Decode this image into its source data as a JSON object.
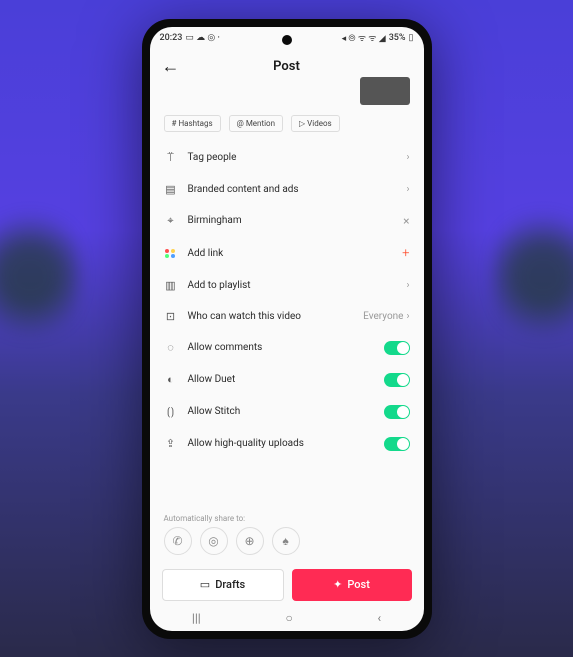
{
  "status": {
    "time": "20:23",
    "battery": "35%"
  },
  "header": {
    "title": "Post"
  },
  "chips": {
    "hashtags": "Hashtags",
    "mention": "Mention",
    "videos": "Videos"
  },
  "rows": {
    "tag_people": "Tag people",
    "branded": "Branded content and ads",
    "location": "Birmingham",
    "add_link": "Add link",
    "playlist": "Add to playlist",
    "privacy_label": "Who can watch this video",
    "privacy_value": "Everyone",
    "comments": "Allow comments",
    "duet": "Allow Duet",
    "stitch": "Allow Stitch",
    "hq": "Allow high-quality uploads"
  },
  "share": {
    "hint": "Automatically share to:"
  },
  "footer": {
    "drafts": "Drafts",
    "post": "Post"
  }
}
